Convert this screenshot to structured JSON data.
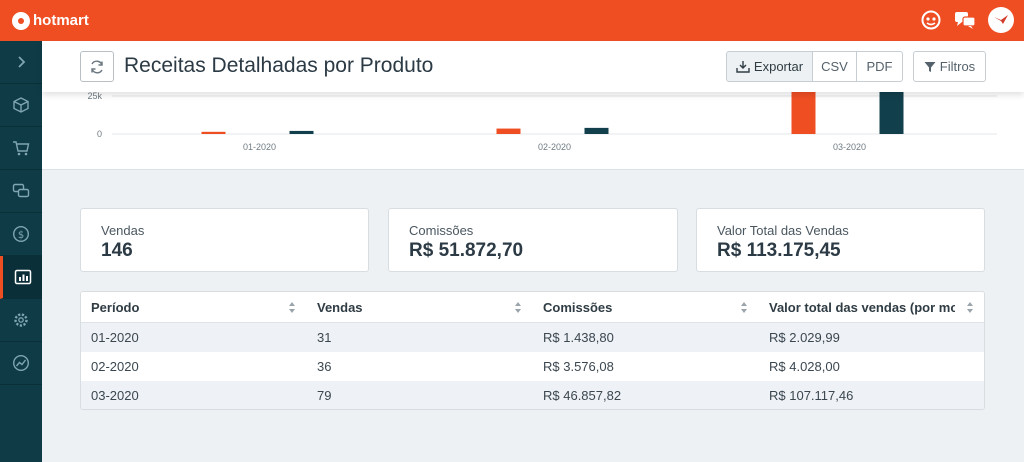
{
  "app": {
    "brand": "hotmart",
    "colors": {
      "brand": "#ef4e23",
      "sidebar": "#0f3b47",
      "series_orange": "#ef4e23",
      "series_dark": "#123f4c"
    }
  },
  "topbar": {
    "icons": [
      "support-icon",
      "chat-icon",
      "avatar"
    ]
  },
  "sidebar": {
    "items": [
      "chevron-right-icon",
      "box-icon",
      "cart-icon",
      "chat-bubbles-icon",
      "dollar-icon",
      "bar-chart-icon",
      "gear-icon",
      "trend-icon"
    ],
    "active": "bar-chart-icon"
  },
  "header": {
    "title": "Receitas Detalhadas por Produto",
    "export_label": "Exportar",
    "csv_label": "CSV",
    "pdf_label": "PDF",
    "filter_label": "Filtros"
  },
  "chart_data": {
    "type": "bar",
    "categories": [
      "01-2020",
      "02-2020",
      "03-2020"
    ],
    "series": [
      {
        "values": [
          1438.8,
          3576.08,
          46857.82
        ],
        "color": "#ef4e23"
      },
      {
        "values": [
          2029.99,
          4028.0,
          107117.46
        ],
        "color": "#123f4c"
      }
    ],
    "y_ticks_visible": [
      "0",
      "25k"
    ],
    "y_tick_values": [
      0,
      25000
    ],
    "ylim": [
      0,
      25000
    ],
    "grid": "horizontal"
  },
  "stats": {
    "sales_label": "Vendas",
    "sales_value": "146",
    "commission_label": "Comissões",
    "commission_value": "R$ 51.872,70",
    "total_label": "Valor Total das Vendas",
    "total_value": "R$ 113.175,45"
  },
  "table": {
    "headers": [
      "Período",
      "Vendas",
      "Comissões",
      "Valor total das vendas (por mo"
    ],
    "rows": [
      [
        "01-2020",
        "31",
        "R$ 1.438,80",
        "R$ 2.029,99"
      ],
      [
        "02-2020",
        "36",
        "R$ 3.576,08",
        "R$ 4.028,00"
      ],
      [
        "03-2020",
        "79",
        "R$ 46.857,82",
        "R$ 107.117,46"
      ]
    ]
  }
}
